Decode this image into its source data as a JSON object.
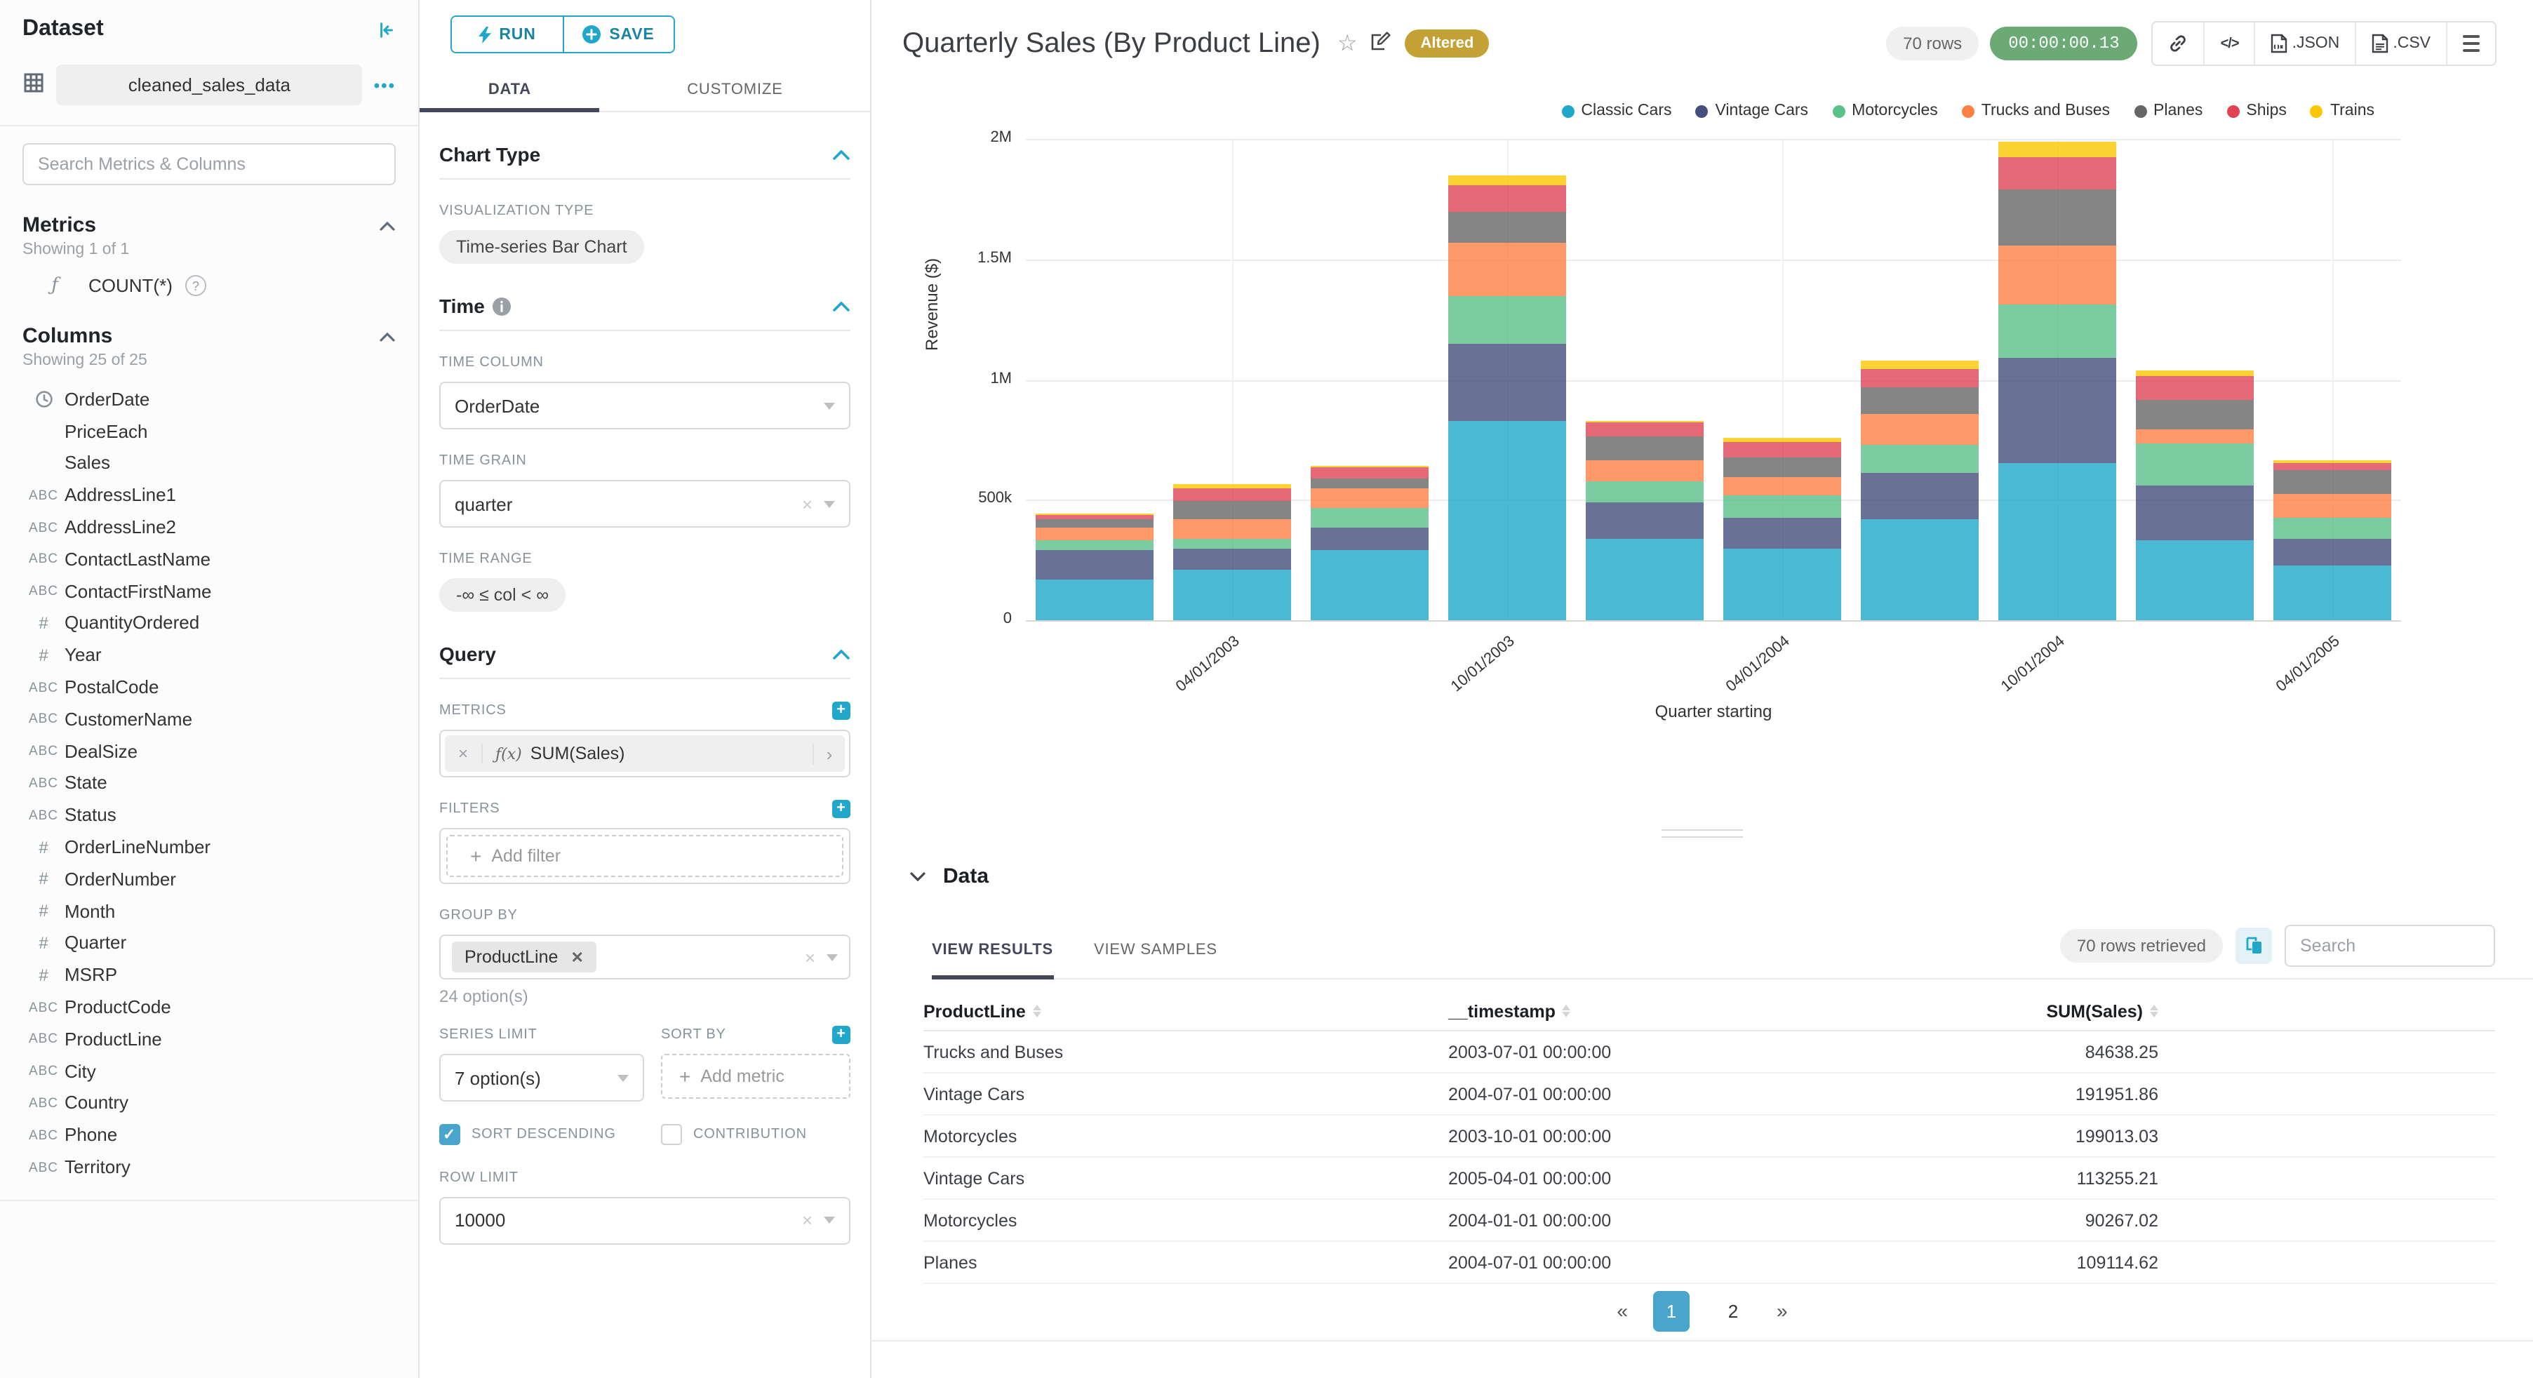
{
  "colors": {
    "accent": "#20A7C9",
    "tab_underline": "#45485B",
    "altered_badge": "#C4A135",
    "timer_green": "#6BAA75",
    "pagination_active": "#49A5CC"
  },
  "sidebar": {
    "title": "Dataset",
    "collapse_icon": "collapse-left-icon",
    "dataset_name": "cleaned_sales_data",
    "dataset_menu_icon": "ellipsis-icon",
    "search_placeholder": "Search Metrics & Columns",
    "metrics": {
      "title": "Metrics",
      "showing": "Showing 1 of 1",
      "items": [
        {
          "icon": "function-icon",
          "label": "COUNT(*)",
          "help_icon": "question-circle-icon"
        }
      ]
    },
    "columns": {
      "title": "Columns",
      "showing": "Showing 25 of 25",
      "items": [
        {
          "icon": "clock-icon",
          "label": "OrderDate"
        },
        {
          "icon": "",
          "label": "PriceEach"
        },
        {
          "icon": "",
          "label": "Sales"
        },
        {
          "icon": "abc-icon",
          "label": "AddressLine1"
        },
        {
          "icon": "abc-icon",
          "label": "AddressLine2"
        },
        {
          "icon": "abc-icon",
          "label": "ContactLastName"
        },
        {
          "icon": "abc-icon",
          "label": "ContactFirstName"
        },
        {
          "icon": "hash-icon",
          "label": "QuantityOrdered"
        },
        {
          "icon": "hash-icon",
          "label": "Year"
        },
        {
          "icon": "abc-icon",
          "label": "PostalCode"
        },
        {
          "icon": "abc-icon",
          "label": "CustomerName"
        },
        {
          "icon": "abc-icon",
          "label": "DealSize"
        },
        {
          "icon": "abc-icon",
          "label": "State"
        },
        {
          "icon": "abc-icon",
          "label": "Status"
        },
        {
          "icon": "hash-icon",
          "label": "OrderLineNumber"
        },
        {
          "icon": "hash-icon",
          "label": "OrderNumber"
        },
        {
          "icon": "hash-icon",
          "label": "Month"
        },
        {
          "icon": "hash-icon",
          "label": "Quarter"
        },
        {
          "icon": "hash-icon",
          "label": "MSRP"
        },
        {
          "icon": "abc-icon",
          "label": "ProductCode"
        },
        {
          "icon": "abc-icon",
          "label": "ProductLine"
        },
        {
          "icon": "abc-icon",
          "label": "City"
        },
        {
          "icon": "abc-icon",
          "label": "Country"
        },
        {
          "icon": "abc-icon",
          "label": "Phone"
        },
        {
          "icon": "abc-icon",
          "label": "Territory"
        }
      ]
    }
  },
  "controls": {
    "run_label": "RUN",
    "save_label": "SAVE",
    "tabs": [
      {
        "label": "DATA",
        "active": true
      },
      {
        "label": "CUSTOMIZE",
        "active": false
      }
    ],
    "chart_type": {
      "section": "Chart Type",
      "viz_label": "VISUALIZATION TYPE",
      "viz_value": "Time-series Bar Chart"
    },
    "time": {
      "section": "Time",
      "column_label": "TIME COLUMN",
      "column_value": "OrderDate",
      "grain_label": "TIME GRAIN",
      "grain_value": "quarter",
      "range_label": "TIME RANGE",
      "range_value": "-∞ ≤ col < ∞"
    },
    "query": {
      "section": "Query",
      "metrics_label": "METRICS",
      "metric_prefix": "ƒ(x)",
      "metric_value": "SUM(Sales)",
      "filters_label": "FILTERS",
      "add_filter": "Add filter",
      "group_by_label": "GROUP BY",
      "group_by_value": "ProductLine",
      "group_by_options": "24 option(s)",
      "series_limit_label": "SERIES LIMIT",
      "series_limit_value": "7 option(s)",
      "sort_by_label": "SORT BY",
      "add_metric": "Add metric",
      "sort_descending_label": "SORT DESCENDING",
      "sort_descending_checked": true,
      "contribution_label": "CONTRIBUTION",
      "contribution_checked": false,
      "row_limit_label": "ROW LIMIT",
      "row_limit_value": "10000"
    }
  },
  "header": {
    "title": "Quarterly Sales (By Product Line)",
    "altered_badge": "Altered",
    "rows_pill": "70 rows",
    "timer": "00:00:00.13",
    "export_json": ".JSON",
    "export_csv": ".CSV"
  },
  "chart_data": {
    "type": "bar",
    "stacked": true,
    "title": "Quarterly Sales (By Product Line)",
    "xlabel": "Quarter starting",
    "ylabel": "Revenue ($)",
    "ylim": [
      0,
      2000000
    ],
    "grid": true,
    "legend_position": "top-right",
    "y_ticks": [
      "0",
      "500k",
      "1M",
      "1.5M",
      "2M"
    ],
    "x_tick_labels": [
      "04/01/2003",
      "10/01/2003",
      "04/01/2004",
      "10/01/2004",
      "04/01/2005"
    ],
    "x_tick_slots": [
      1,
      3,
      5,
      7,
      9
    ],
    "categories": [
      "2003-01-01",
      "2003-04-01",
      "2003-07-01",
      "2003-10-01",
      "2004-01-01",
      "2004-04-01",
      "2004-07-01",
      "2004-10-01",
      "2005-01-01",
      "2005-04-01"
    ],
    "series": [
      {
        "name": "Classic Cars",
        "color": "#1FA8C9",
        "values": [
          170000,
          210000,
          290000,
          830000,
          340000,
          300000,
          420000,
          655000,
          335000,
          225000
        ]
      },
      {
        "name": "Vintage Cars",
        "color": "#454E7C",
        "values": [
          120000,
          90000,
          95000,
          320000,
          150000,
          125000,
          191951.86,
          434000,
          226000,
          113255.21
        ]
      },
      {
        "name": "Motorcycles",
        "color": "#5AC189",
        "values": [
          40000,
          40000,
          80000,
          199013.03,
          90267.02,
          95000,
          117000,
          226000,
          175000,
          88000
        ]
      },
      {
        "name": "Trucks and Buses",
        "color": "#FF7F44",
        "values": [
          55000,
          80000,
          84638.25,
          220000,
          85000,
          78000,
          130000,
          244000,
          54000,
          99000
        ]
      },
      {
        "name": "Planes",
        "color": "#666666",
        "values": [
          35000,
          75000,
          40000,
          130000,
          100000,
          80000,
          109114.62,
          233000,
          127000,
          96000
        ]
      },
      {
        "name": "Ships",
        "color": "#E04355",
        "values": [
          15000,
          55000,
          45000,
          110000,
          55000,
          62000,
          78000,
          134000,
          99000,
          31000
        ]
      },
      {
        "name": "Trains",
        "color": "#FCC700",
        "values": [
          10000,
          15000,
          10000,
          40000,
          10000,
          18000,
          31000,
          64000,
          24000,
          14000
        ]
      }
    ]
  },
  "datapanel": {
    "title": "Data",
    "tabs": [
      {
        "label": "VIEW RESULTS",
        "active": true
      },
      {
        "label": "VIEW SAMPLES",
        "active": false
      }
    ],
    "rows_retrieved": "70 rows retrieved",
    "search_placeholder": "Search",
    "columns": [
      "ProductLine",
      "__timestamp",
      "SUM(Sales)"
    ],
    "rows": [
      [
        "Trucks and Buses",
        "2003-07-01 00:00:00",
        "84638.25"
      ],
      [
        "Vintage Cars",
        "2004-07-01 00:00:00",
        "191951.86"
      ],
      [
        "Motorcycles",
        "2003-10-01 00:00:00",
        "199013.03"
      ],
      [
        "Vintage Cars",
        "2005-04-01 00:00:00",
        "113255.21"
      ],
      [
        "Motorcycles",
        "2004-01-01 00:00:00",
        "90267.02"
      ],
      [
        "Planes",
        "2004-07-01 00:00:00",
        "109114.62"
      ]
    ],
    "pagination": {
      "prev": "«",
      "pages": [
        "1",
        "2"
      ],
      "active": "1",
      "next": "»"
    }
  }
}
